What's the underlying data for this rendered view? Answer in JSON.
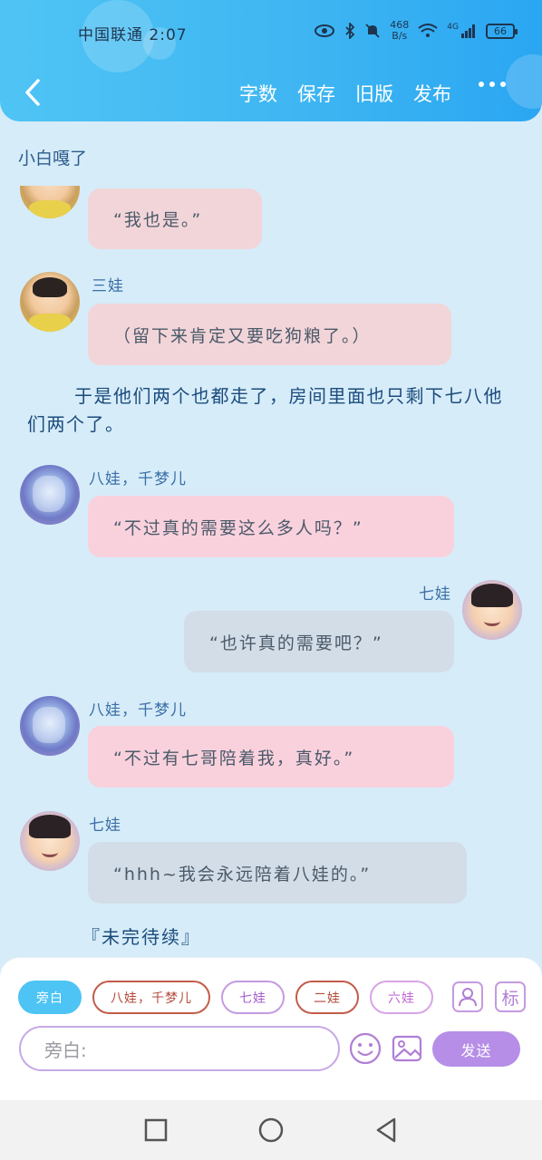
{
  "status_bar": {
    "carrier_time": "中国联通 2:07",
    "net_speed_value": "468",
    "net_speed_unit": "B/s",
    "network_type": "4G",
    "battery": "66"
  },
  "toolbar": {
    "word_count": "字数",
    "save": "保存",
    "old_version": "旧版",
    "publish": "发布"
  },
  "page_subtitle": "小白嘎了",
  "messages": [
    {
      "speaker": "",
      "text": "“我也是。”"
    },
    {
      "speaker": "三娃",
      "text": "（留下来肯定又要吃狗粮了。）"
    },
    {
      "speaker": "八娃，千梦儿",
      "text": "“不过真的需要这么多人吗？”"
    },
    {
      "speaker": "七娃",
      "text": "“也许真的需要吧？”"
    },
    {
      "speaker": "八娃，千梦儿",
      "text": "“不过有七哥陪着我，真好。”"
    },
    {
      "speaker": "七娃",
      "text": "“hhh~我会永远陪着八娃的。”"
    }
  ],
  "narration": "于是他们两个也都走了，房间里面也只剩下七八他们两个了。",
  "to_be_continued": "『未完待续』",
  "roles": [
    "旁白",
    "八娃，千梦儿",
    "七娃",
    "二娃",
    "六娃"
  ],
  "role_button_label": "标",
  "input": {
    "prefix": "旁白:"
  },
  "send_label": "发送",
  "colors": {
    "header": "#3fb6f2",
    "active_role": "#4ec4f5",
    "send": "#b68ee8",
    "pink_bubble": "#f9d1dd",
    "gray_bubble": "#d2dde8"
  }
}
